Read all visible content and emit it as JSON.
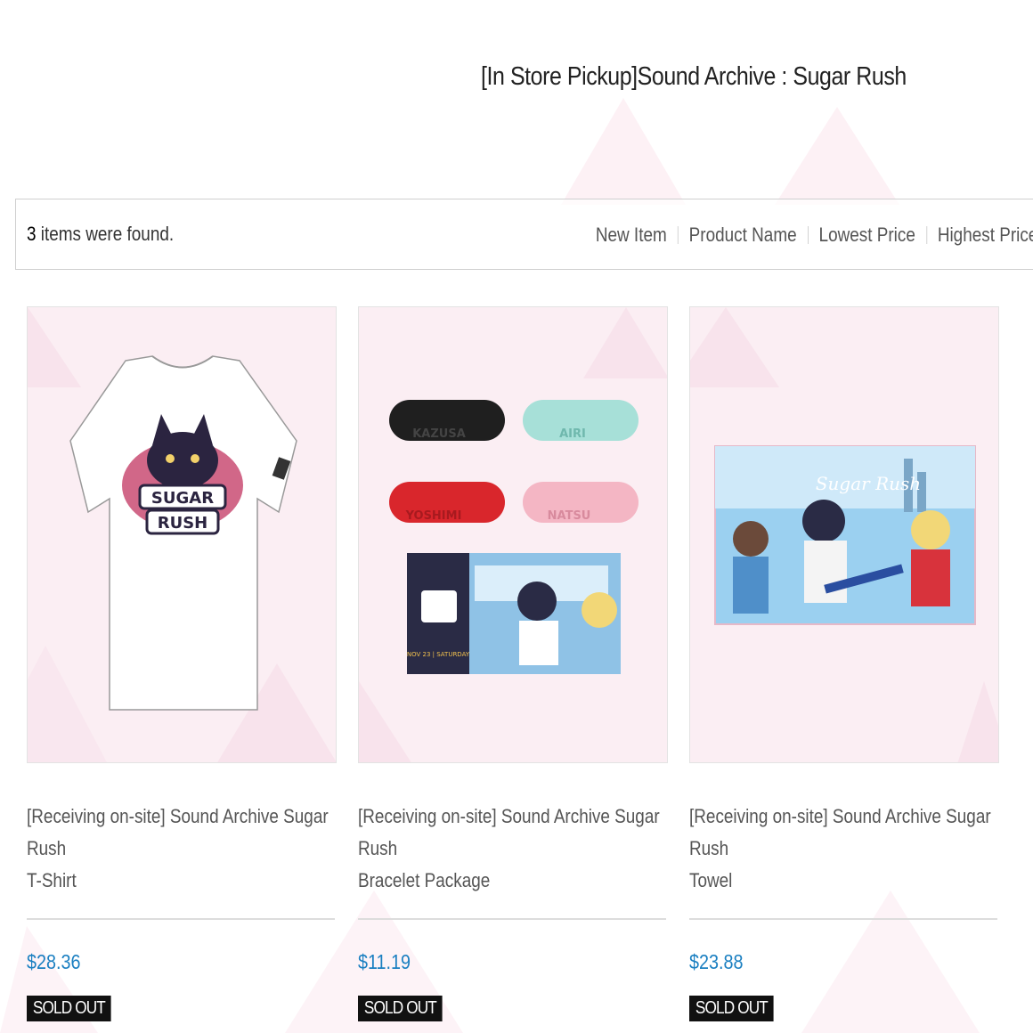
{
  "page": {
    "title": "[In Store Pickup]Sound Archive : Sugar Rush"
  },
  "results": {
    "count": "3",
    "suffix": " items were found."
  },
  "sort": {
    "options": [
      "New Item",
      "Product Name",
      "Lowest Price",
      "Highest Price"
    ]
  },
  "products": [
    {
      "name_line1": "[Receiving on-site] Sound Archive Sugar Rush",
      "name_line2": "T-Shirt",
      "price": "$28.36",
      "status": "SOLD OUT",
      "image": "tshirt-image",
      "shirt_print": "SUGAR RUSH"
    },
    {
      "name_line1": "[Receiving on-site] Sound Archive Sugar Rush",
      "name_line2": "Bracelet Package",
      "price": "$11.19",
      "status": "SOLD OUT",
      "image": "bracelet-package-image",
      "bands": [
        "KAZUSA",
        "AIRI",
        "YOSHIMI",
        "NATSU"
      ],
      "card_text": "NOV 23 | SATURDAY"
    },
    {
      "name_line1": "[Receiving on-site] Sound Archive Sugar Rush",
      "name_line2": "Towel",
      "price": "$23.88",
      "status": "SOLD OUT",
      "image": "towel-image",
      "towel_text": "Sugar Rush"
    }
  ],
  "colors": {
    "price": "#1a7fc1",
    "soldout_bg": "#111111",
    "background_tint": "#fbe9f1"
  }
}
